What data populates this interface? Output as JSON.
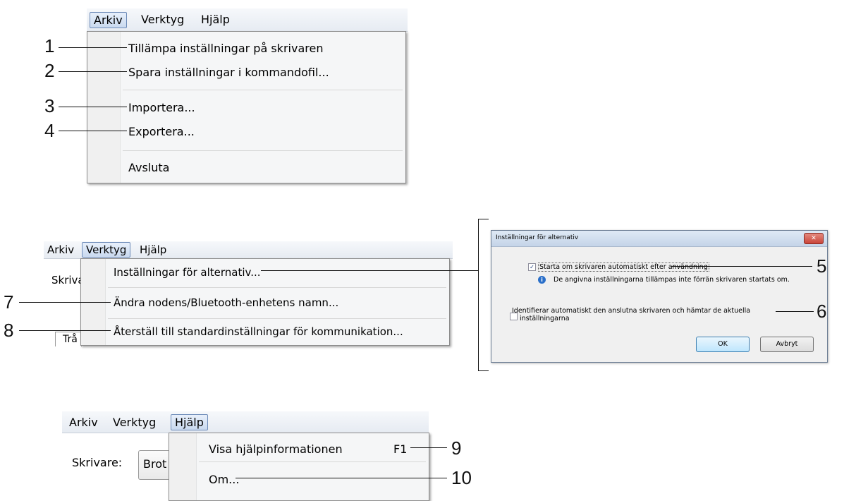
{
  "menubar_labels": {
    "arkiv": "Arkiv",
    "verktyg": "Verktyg",
    "hjalp": "Hjälp"
  },
  "panel1": {
    "items": [
      "Tillämpa inställningar på skrivaren",
      "Spara inställningar i kommandofil...",
      "Importera...",
      "Exportera...",
      "Avsluta"
    ],
    "callouts": [
      "1",
      "2",
      "3",
      "4"
    ]
  },
  "panel2": {
    "background_label": "Skriva",
    "background_tab": "Trå",
    "items": [
      "Inställningar för alternativ...",
      "Ändra nodens/Bluetooth-enhetens namn...",
      "Återställ till standardinställningar för kommunikation..."
    ],
    "callouts": [
      "7",
      "8"
    ]
  },
  "dialog": {
    "title": "Inställningar för alternativ",
    "close_glyph": "✕",
    "option1_label": "Starta om skrivaren automatiskt efter användning",
    "option1_checked": true,
    "info_text": "De angivna inställningarna tillämpas inte förrän skrivaren startats om.",
    "option2_line1": "Identifierar automatiskt den anslutna skrivaren och hämtar de aktuella",
    "option2_line2": "inställningarna",
    "option2_checked": false,
    "ok_label": "OK",
    "cancel_label": "Avbryt",
    "callouts": [
      "5",
      "6"
    ]
  },
  "panel3": {
    "background_label": "Skrivare:",
    "background_combo": "Brot",
    "items": [
      "Visa hjälpinformationen",
      "Om..."
    ],
    "shortcut": "F1",
    "callouts": [
      "9",
      "10"
    ]
  },
  "colors": {
    "menu_highlight_border": "#6d8bb8",
    "close_button": "#c9453a",
    "info_icon": "#2a6fc9"
  },
  "icons": {
    "info": "info-icon",
    "close": "close-icon",
    "check": "check-icon"
  }
}
